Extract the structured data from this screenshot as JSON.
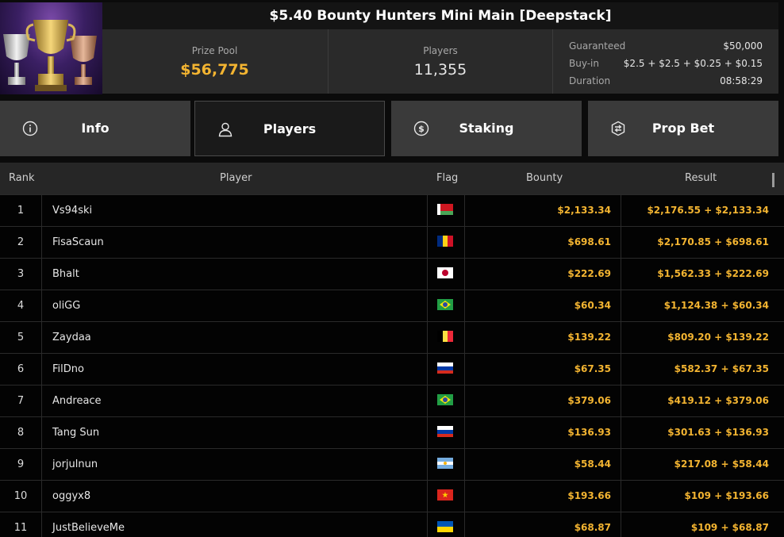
{
  "tournament": {
    "title": "$5.40 Bounty Hunters Mini Main [Deepstack]",
    "prize_pool_label": "Prize Pool",
    "prize_pool_value": "$56,775",
    "players_label": "Players",
    "players_value": "11,355",
    "details": [
      {
        "key": "Guaranteed",
        "value": "$50,000"
      },
      {
        "key": "Buy-in",
        "value": "$2.5 + $2.5 + $0.25 + $0.15"
      },
      {
        "key": "Duration",
        "value": "08:58:29"
      }
    ]
  },
  "tabs": [
    {
      "label": "Info",
      "icon": "info-icon",
      "active": false
    },
    {
      "label": "Players",
      "icon": "user-icon",
      "active": true
    },
    {
      "label": "Staking",
      "icon": "dollar-coin-icon",
      "active": false
    },
    {
      "label": "Prop Bet",
      "icon": "prop-bet-icon",
      "active": false
    }
  ],
  "table": {
    "headers": {
      "rank": "Rank",
      "player": "Player",
      "flag": "Flag",
      "bounty": "Bounty",
      "result": "Result"
    },
    "rows": [
      {
        "rank": "1",
        "player": "Vs94ski",
        "flag": "belarus",
        "bounty": "$2,133.34",
        "result": "$2,176.55 + $2,133.34"
      },
      {
        "rank": "2",
        "player": "FisaScaun",
        "flag": "romania",
        "bounty": "$698.61",
        "result": "$2,170.85 + $698.61"
      },
      {
        "rank": "3",
        "player": "Bhalt",
        "flag": "japan",
        "bounty": "$222.69",
        "result": "$1,562.33 + $222.69"
      },
      {
        "rank": "4",
        "player": "oliGG",
        "flag": "brazil",
        "bounty": "$60.34",
        "result": "$1,124.38 + $60.34"
      },
      {
        "rank": "5",
        "player": "Zaydaa",
        "flag": "belgium",
        "bounty": "$139.22",
        "result": "$809.20 + $139.22"
      },
      {
        "rank": "6",
        "player": "FilDno",
        "flag": "russia",
        "bounty": "$67.35",
        "result": "$582.37 + $67.35"
      },
      {
        "rank": "7",
        "player": "Andreace",
        "flag": "brazil",
        "bounty": "$379.06",
        "result": "$419.12 + $379.06"
      },
      {
        "rank": "8",
        "player": "Tang Sun",
        "flag": "russia",
        "bounty": "$136.93",
        "result": "$301.63 + $136.93"
      },
      {
        "rank": "9",
        "player": "jorjulnun",
        "flag": "argentina",
        "bounty": "$58.44",
        "result": "$217.08 + $58.44"
      },
      {
        "rank": "10",
        "player": "oggyx8",
        "flag": "vietnam",
        "bounty": "$193.66",
        "result": "$109 + $193.66"
      },
      {
        "rank": "11",
        "player": "JustBelieveMe",
        "flag": "ukraine",
        "bounty": "$68.87",
        "result": "$109 + $68.87"
      }
    ]
  },
  "colors": {
    "accent_gold": "#f3b431",
    "tab_bg": "#3a3a3a",
    "active_tab_bg": "#1a1a1a"
  }
}
